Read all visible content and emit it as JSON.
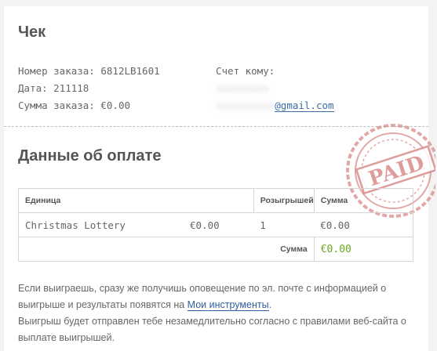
{
  "receipt": {
    "title": "Чек",
    "order_number_label": "Номер заказа:",
    "order_number": "6812LB1601",
    "date_label": "Дата:",
    "date": "211118",
    "amount_label": "Сумма заказа:",
    "amount": "€0.00",
    "bill_to_label": "Счет кому:",
    "email_visible_part": "@gmail.com"
  },
  "payment": {
    "title": "Данные об оплате",
    "stamp_text": "PAID",
    "columns": [
      "Единица",
      "Розыгрышей",
      "Сумма"
    ],
    "rows": [
      {
        "item": "Christmas Lottery",
        "price": "€0.00",
        "draws": "1",
        "sum": "€0.00"
      }
    ],
    "total_label": "Сумма",
    "total_value": "€0.00"
  },
  "note": {
    "line1": "Если выиграешь, сразу же получишь оповещение по эл. почте с информацией о выигрыше и результаты появятся на",
    "link": "Мои инструменты",
    "line1_end": ".",
    "line2": "Выигрыш будет отправлен тебе незамедлительно согласно с правилами веб-сайта о выплате выигрышей."
  },
  "colors": {
    "accent_green": "#6aaa1e",
    "link_blue": "#2f5f9e",
    "stamp_red": "#d98b8b"
  }
}
